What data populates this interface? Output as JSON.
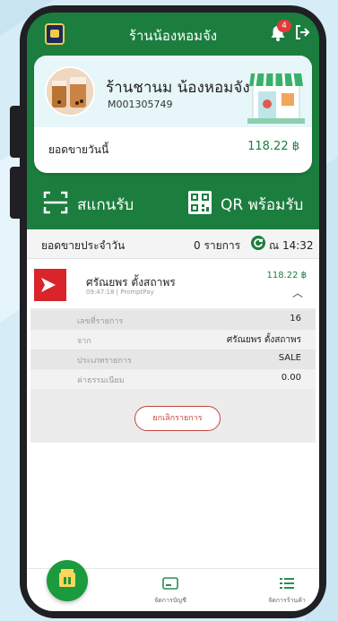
{
  "header": {
    "shop_title": "ร้านน้องหอมจัง",
    "notification_count": "4"
  },
  "shop_card": {
    "name": "ร้านชานม น้องหอมจัง",
    "merchant_id": "M001305749",
    "today_sales_label": "ยอดขายวันนี้",
    "today_sales_amount": "118.22 ฿"
  },
  "actions": {
    "scan_label": "สแกนรับ",
    "qr_label": "QR พร้อมรับ"
  },
  "daily": {
    "label": "ยอดขายประจำวัน",
    "count": "0 รายการ",
    "time": "ณ 14:32"
  },
  "transaction": {
    "name": "ศรัณยพร ตั้งสถาพร",
    "meta": "09:47:18 | PromptPay",
    "amount": "118.22 ฿",
    "details": [
      {
        "key": "เลขที่รายการ",
        "value": "16"
      },
      {
        "key": "จาก",
        "value": "ศรัณยพร ตั้งสถาพร"
      },
      {
        "key": "ประเภทรายการ",
        "value": "SALE"
      },
      {
        "key": "ค่าธรรมเนียม",
        "value": "0.00"
      }
    ],
    "cancel_label": "ยกเลิกรายการ"
  },
  "bottom_nav": {
    "items": [
      {
        "label": "จัดการบัญชี"
      },
      {
        "label": "จัดการร้านค้า"
      }
    ]
  },
  "colors": {
    "brand_green": "#1b7e3e",
    "cancel_red": "#c4473f",
    "badge_red": "#e23a3a"
  }
}
